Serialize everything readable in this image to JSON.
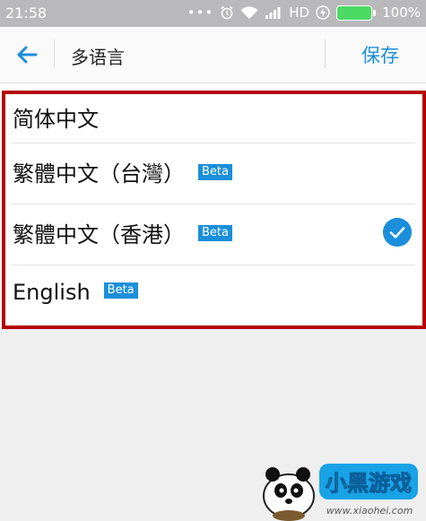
{
  "status_bar": {
    "time": "21:58",
    "dots": "•••",
    "alarm_icon": "alarm-clock-icon",
    "wifi_icon": "wifi-icon",
    "signal_icon": "signal-bars-icon",
    "network": "HD",
    "charging_icon": "charging-bolt-icon",
    "battery_percent": "100%"
  },
  "app_bar": {
    "back_icon": "arrow-left-icon",
    "title": "多语言",
    "save_label": "保存"
  },
  "languages": [
    {
      "label": "简体中文",
      "beta": "",
      "selected": false
    },
    {
      "label": "繁體中文（台灣）",
      "beta": "Beta",
      "selected": false
    },
    {
      "label": "繁體中文（香港）",
      "beta": "Beta",
      "selected": true
    },
    {
      "label": "English",
      "beta": "Beta",
      "selected": false
    }
  ],
  "colors": {
    "accent": "#1b8fdb",
    "highlight_frame": "#b50000",
    "statusbar_bg": "#b9b9bb",
    "battery_green": "#4cd964"
  },
  "watermark": {
    "logo_text": "小黑游戏",
    "url": "www.xiaohei.com"
  }
}
